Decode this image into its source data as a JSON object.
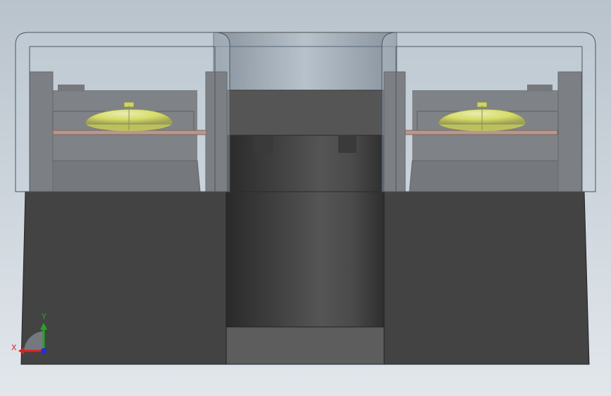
{
  "viewport": {
    "background_top": "#b9c3cc",
    "background_bottom": "#e2e7ec"
  },
  "colors": {
    "housing_dark": "#434343",
    "housing_mid": "#5a5a5a",
    "glass_tint": "#c7d2dc",
    "screw_yellow": "#e6e62e",
    "copper_plate": "#b07a64"
  },
  "triad": {
    "x_label": "X",
    "y_label": "Y",
    "x_color": "#e01f1f",
    "y_color": "#1fa81f",
    "z_color": "#1f2fe0"
  }
}
